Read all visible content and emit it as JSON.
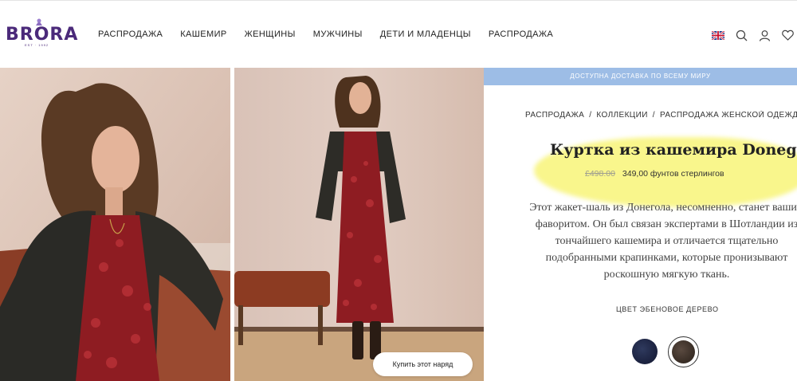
{
  "brand": {
    "logo_text": "BRORA",
    "logo_sub": "EST · 1992"
  },
  "nav": {
    "items": [
      "РАСПРОДАЖА",
      "КАШЕМИР",
      "ЖЕНЩИНЫ",
      "МУЖЧИНЫ",
      "ДЕТИ И МЛАДЕНЦЫ",
      "РАСПРОДАЖА"
    ]
  },
  "header_icons": [
    "uk-flag-icon",
    "search-icon",
    "account-icon",
    "wishlist-heart-icon"
  ],
  "banner": {
    "text": "ДОСТУПНА ДОСТАВКА ПО ВСЕМУ МИРУ"
  },
  "breadcrumb": {
    "items": [
      "РАСПРОДАЖА",
      "КОЛЛЕКЦИИ",
      "РАСПРОДАЖА ЖЕНСКОЙ ОДЕЖДЫ"
    ],
    "separator": "/"
  },
  "product": {
    "title": "Куртка из кашемира Donegal",
    "old_price": "£498.00",
    "price": "349,00 фунтов стерлингов",
    "description": "Этот жакет-шаль из Донегола, несомненно, станет вашим фаворитом. Он был связан экспертами в Шотландии из тончайшего кашемира и отличается тщательно подобранными крапинками, которые пронизывают роскошную мягкую ткань.",
    "color_label": "ЦВЕТ ЭБЕНОВОЕ ДЕРЕВО",
    "swatches": [
      {
        "name": "navy",
        "color": "#1d2442",
        "selected": false
      },
      {
        "name": "ebony",
        "color": "#3c3028",
        "selected": true
      }
    ]
  },
  "buy_outfit": {
    "label": "Купить этот наряд"
  },
  "colors": {
    "brand_purple": "#4b2a7a",
    "banner_blue": "#9dbde6",
    "highlight_yellow": "#f8f578"
  }
}
